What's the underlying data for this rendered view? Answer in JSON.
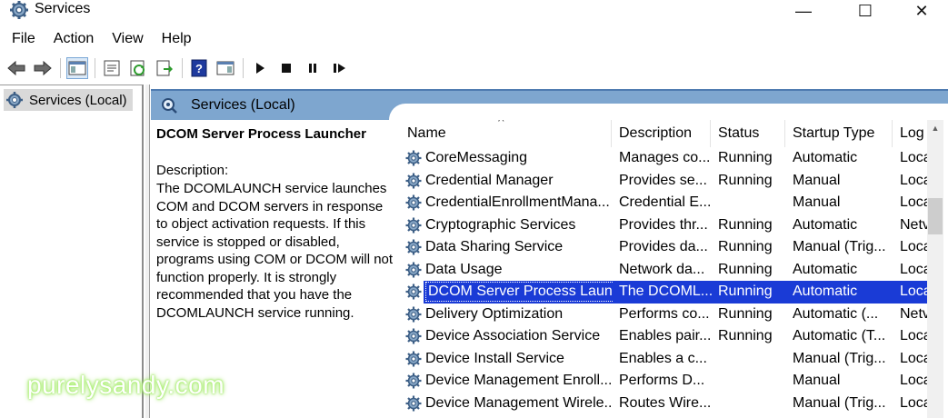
{
  "window": {
    "title": "Services",
    "min_glyph": "—",
    "max_glyph": "☐",
    "close_glyph": "✕"
  },
  "menu": [
    "File",
    "Action",
    "View",
    "Help"
  ],
  "toolbar": {
    "icons": [
      "back-arrow-icon",
      "forward-arrow-icon",
      "show-hide-console-tree-icon",
      "properties-icon",
      "refresh-icon",
      "export-list-icon",
      "help-icon",
      "show-action-pane-icon",
      "start-service-icon",
      "stop-service-icon",
      "pause-service-icon",
      "restart-service-icon"
    ]
  },
  "tree": {
    "selected_item": "Services (Local)"
  },
  "panel": {
    "title": "Services (Local)"
  },
  "details": {
    "service_name": "DCOM Server Process Launcher",
    "description_label": "Description:",
    "description_text": "The DCOMLAUNCH service launches COM and DCOM servers in response to object activation requests. If this service is stopped or disabled, programs using COM or DCOM will not function properly. It is strongly recommended that you have the DCOMLAUNCH service running."
  },
  "columns": {
    "name": "Name",
    "description": "Description",
    "status": "Status",
    "startup_type": "Startup Type",
    "log_on_as": "Log",
    "sort_indicator": "^"
  },
  "services": [
    {
      "name": "CoreMessaging",
      "description": "Manages co...",
      "status": "Running",
      "startup": "Automatic",
      "logon": "Loca"
    },
    {
      "name": "Credential Manager",
      "description": "Provides se...",
      "status": "Running",
      "startup": "Manual",
      "logon": "Loca"
    },
    {
      "name": "CredentialEnrollmentMana...",
      "description": "Credential E...",
      "status": "",
      "startup": "Manual",
      "logon": "Loca"
    },
    {
      "name": "Cryptographic Services",
      "description": "Provides thr...",
      "status": "Running",
      "startup": "Automatic",
      "logon": "Netv"
    },
    {
      "name": "Data Sharing Service",
      "description": "Provides da...",
      "status": "Running",
      "startup": "Manual (Trig...",
      "logon": "Loca"
    },
    {
      "name": "Data Usage",
      "description": "Network da...",
      "status": "Running",
      "startup": "Automatic",
      "logon": "Loca"
    },
    {
      "name": "DCOM Server Process Laun...",
      "description": "The DCOML...",
      "status": "Running",
      "startup": "Automatic",
      "logon": "Loca",
      "selected": true
    },
    {
      "name": "Delivery Optimization",
      "description": "Performs co...",
      "status": "Running",
      "startup": "Automatic (...",
      "logon": "Netv"
    },
    {
      "name": "Device Association Service",
      "description": "Enables pair...",
      "status": "Running",
      "startup": "Automatic (T...",
      "logon": "Loca"
    },
    {
      "name": "Device Install Service",
      "description": "Enables a c...",
      "status": "",
      "startup": "Manual (Trig...",
      "logon": "Loca"
    },
    {
      "name": "Device Management Enroll...",
      "description": "Performs D...",
      "status": "",
      "startup": "Manual",
      "logon": "Loca"
    },
    {
      "name": "Device Management Wirele...",
      "description": "Routes Wire...",
      "status": "",
      "startup": "Manual (Trig...",
      "logon": "Loca"
    }
  ],
  "watermark": "purelysandy.com",
  "colors": {
    "selection": "#1a3bd6",
    "header_band": "#7ea6cf"
  }
}
